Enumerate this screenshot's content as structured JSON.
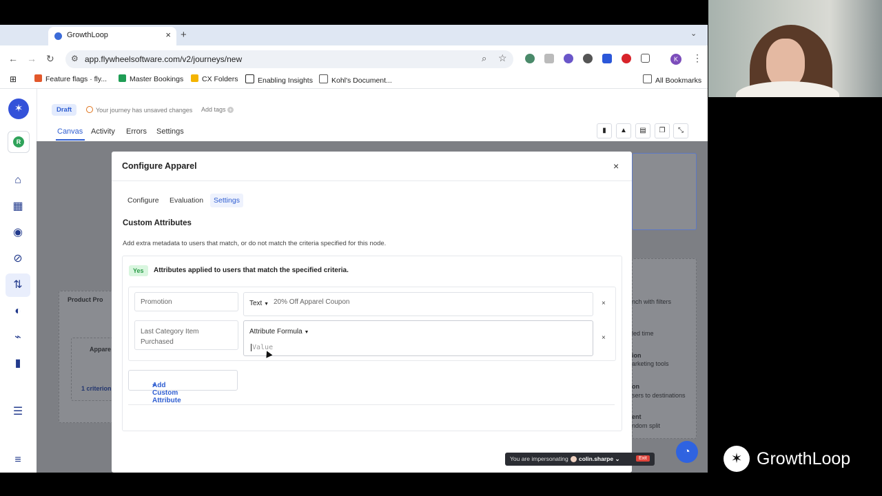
{
  "browser": {
    "tab_title": "GrowthLoop",
    "tab_close": "×",
    "new_tab": "+",
    "tab_menu": "⌄",
    "url": "app.flywheelsoftware.com/v2/journeys/new",
    "back": "←",
    "forward": "→",
    "reload": "↻",
    "profile_initial": "K",
    "bookmarks": [
      "Feature flags · fly...",
      "Master Bookings",
      "CX Folders",
      "Enabling Insights",
      "Kohl's Document..."
    ],
    "all_bookmarks": "All Bookmarks"
  },
  "rail": {
    "workspace_initial": "R"
  },
  "header": {
    "status_badge": "Draft",
    "unsaved_text": "Your journey has unsaved changes",
    "add_tags": "Add tags",
    "tabs": [
      "Canvas",
      "Activity",
      "Errors",
      "Settings"
    ]
  },
  "canvas": {
    "ghost_node_title": "Product Pro",
    "ghost_child_title": "Appare",
    "ghost_criterion": "1 criterion",
    "side_texts": [
      "nch with filters",
      "led time",
      "ion",
      "arketing tools",
      "on",
      "sers to destinations",
      "ent",
      "ndom split"
    ]
  },
  "modal": {
    "title": "Configure Apparel",
    "close": "×",
    "tabs": [
      "Configure",
      "Evaluation",
      "Settings"
    ],
    "active_tab": "Settings",
    "section_title": "Custom Attributes",
    "section_desc": "Add extra metadata to users that match, or do not match the criteria specified for this node.",
    "match_badge": "Yes",
    "match_text": "Attributes applied to users that match the specified criteria.",
    "rows": [
      {
        "key": "Promotion",
        "type": "Text",
        "value": "20% Off Apparel Coupon",
        "remove": "×"
      },
      {
        "key": "Last Category Item Purchased",
        "type": "Attribute Formula",
        "placeholder": "Value",
        "remove": "×"
      }
    ],
    "add_button": "Add Custom Attribute"
  },
  "impersonation": {
    "text": "You are impersonating",
    "user": "colin.sharpe",
    "exit": "Exit"
  },
  "overlay_brand": "GrowthLoop"
}
